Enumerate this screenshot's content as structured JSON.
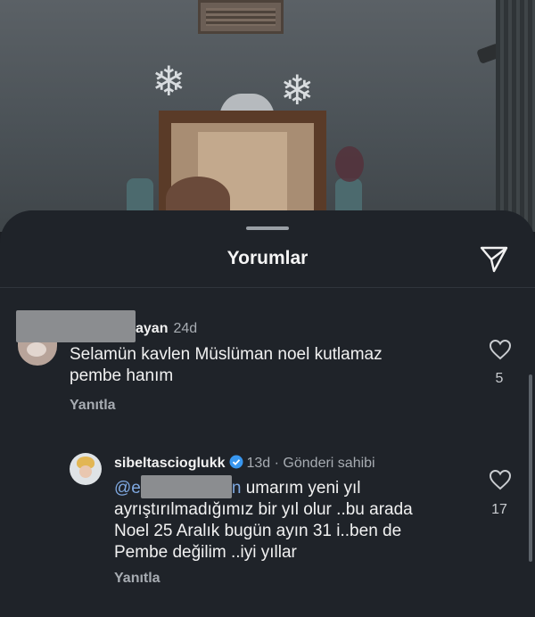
{
  "sheet": {
    "title": "Yorumlar"
  },
  "comments": [
    {
      "username_visible": "ayan",
      "time": "24d",
      "text": "Selamün kavlen Müslüman noel kutlamaz pembe hanım",
      "reply_label": "Yanıtla",
      "like_count": "5"
    },
    {
      "username": "sibeltascioglukk",
      "verified": true,
      "time": "13d",
      "author_tag": "· Gönderi sahibi",
      "mention_prefix": "@e",
      "mention_suffix": "n",
      "text": " umarım yeni yıl ayrıştırılmadığımız bir yıl olur ..bu arada Noel 25 Aralık bugün ayın 31 i..ben de Pembe değilim ..iyi yıllar",
      "reply_label": "Yanıtla",
      "like_count": "17"
    }
  ],
  "icons": {
    "send": "paper-plane-icon",
    "like": "heart-icon",
    "verified": "verified-badge-icon"
  },
  "colors": {
    "sheet_bg": "#1f2329",
    "mention": "#7fa8e0",
    "verified": "#3897f0"
  }
}
